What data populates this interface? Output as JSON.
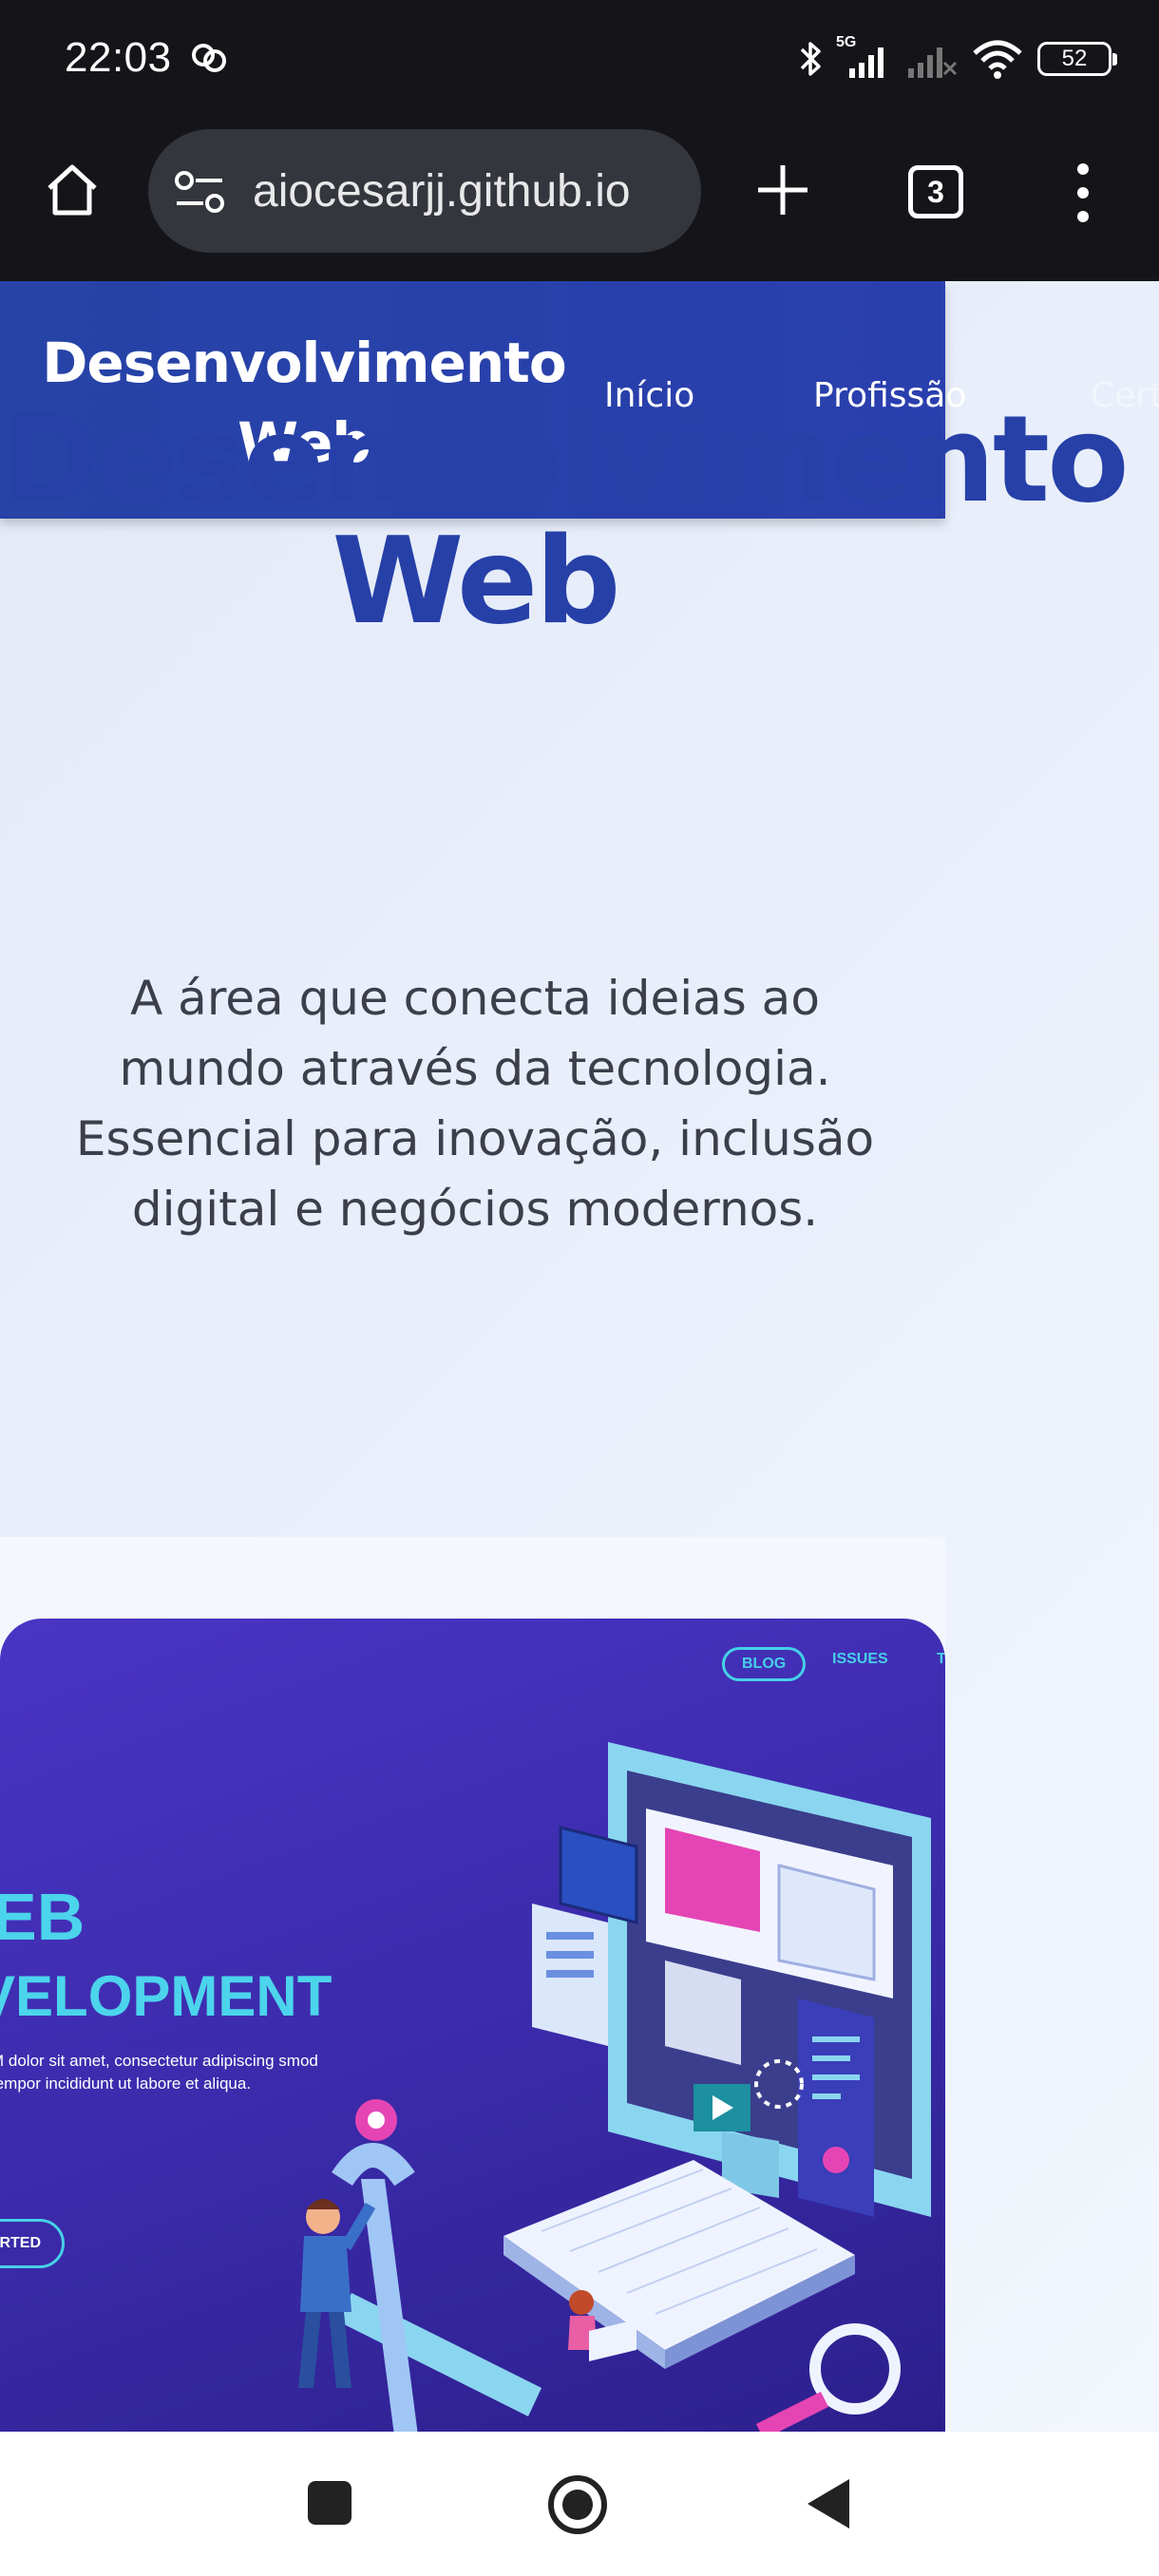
{
  "status_bar": {
    "time": "22:03",
    "network": "5G",
    "battery": "52",
    "icons": [
      "notification-app-icon",
      "bluetooth-icon",
      "signal-icon",
      "signal-off-icon",
      "wifi-icon",
      "battery-icon"
    ]
  },
  "browser": {
    "url": "aiocesarjj.github.io",
    "tab_count": "3",
    "icons": [
      "home-icon",
      "site-settings-icon",
      "plus-icon",
      "tabs-icon",
      "more-vert-icon"
    ]
  },
  "site": {
    "logo": "Desenvolvimento Web",
    "nav": [
      {
        "label": "Início"
      },
      {
        "label": "Profissão"
      },
      {
        "label": "Cert"
      }
    ]
  },
  "hero": {
    "title": "Desenvolvimento Web",
    "text": "A área que conecta ideias ao mundo através da tecnologia. Essencial para inovação, inclusão digital e negócios modernos."
  },
  "hero_image": {
    "nav_pill": "BLOG",
    "nav_link": "ISSUES",
    "nav_extra": "T",
    "heading_line1": "EB",
    "heading_line2": "VELOPMENT",
    "copy": "M dolor sit amet, consectetur adipiscing smod tempor incididunt ut labore et aliqua.",
    "button": "RTED"
  },
  "colors": {
    "header_blue": "#2a3fae",
    "title_blue": "#2640a8",
    "accent_cyan": "#46d0e8"
  },
  "android_nav": {
    "icons": [
      "recents-icon",
      "home-circle-icon",
      "back-icon"
    ]
  }
}
